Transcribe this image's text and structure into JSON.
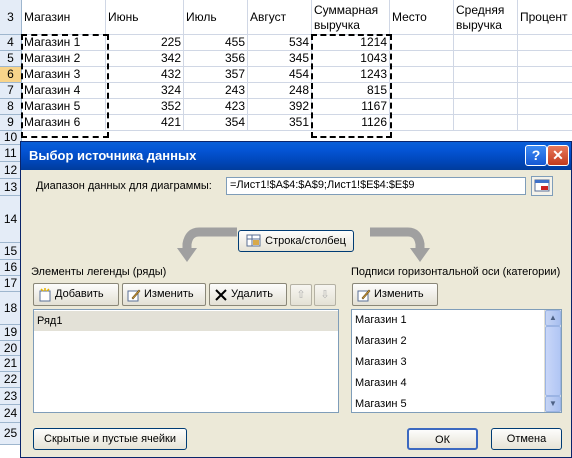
{
  "sheet": {
    "headers": {
      "magazin": "Магазин",
      "june": "Июнь",
      "july": "Июль",
      "august": "Август",
      "sum": "Суммарная выручка",
      "place": "Место",
      "avg": "Средняя выручка",
      "percent": "Процент"
    },
    "row_numbers": [
      "3",
      "4",
      "5",
      "6",
      "7",
      "8",
      "9",
      "10",
      "11",
      "12",
      "13",
      "14",
      "15",
      "16",
      "17",
      "18",
      "19",
      "20",
      "21",
      "22",
      "23",
      "24",
      "25"
    ],
    "rows": [
      {
        "name": "Магазин 1",
        "june": "225",
        "july": "455",
        "august": "534",
        "sum": "1214"
      },
      {
        "name": "Магазин 2",
        "june": "342",
        "july": "356",
        "august": "345",
        "sum": "1043"
      },
      {
        "name": "Магазин 3",
        "june": "432",
        "july": "357",
        "august": "454",
        "sum": "1243"
      },
      {
        "name": "Магазин 4",
        "june": "324",
        "july": "243",
        "august": "248",
        "sum": "815"
      },
      {
        "name": "Магазин 5",
        "june": "352",
        "july": "423",
        "august": "392",
        "sum": "1167"
      },
      {
        "name": "Магазин 6",
        "june": "421",
        "july": "354",
        "august": "351",
        "sum": "1126"
      }
    ]
  },
  "dialog": {
    "title": "Выбор источника данных",
    "help_label": "?",
    "close_label": "✕",
    "range_label": "Диапазон данных для диаграммы:",
    "range_value": "=Лист1!$A$4:$A$9;Лист1!$E$4:$E$9",
    "switch_label": "Строка/столбец",
    "legend_title": "Элементы легенды (ряды)",
    "add_label": "Добавить",
    "edit_label": "Изменить",
    "delete_label": "Удалить",
    "up_label": "⇧",
    "down_label": "⇩",
    "series": [
      "Ряд1"
    ],
    "axis_title": "Подписи горизонтальной оси (категории)",
    "axis_edit_label": "Изменить",
    "categories": [
      "Магазин 1",
      "Магазин 2",
      "Магазин 3",
      "Магазин 4",
      "Магазин 5"
    ],
    "hidden_cells_label": "Скрытые и пустые ячейки",
    "ok_label": "ОК",
    "cancel_label": "Отмена"
  },
  "colors": {
    "title_bar": "#0454d4",
    "dialog_bg": "#ece9d8",
    "active_row_header": "#f8d48a"
  }
}
